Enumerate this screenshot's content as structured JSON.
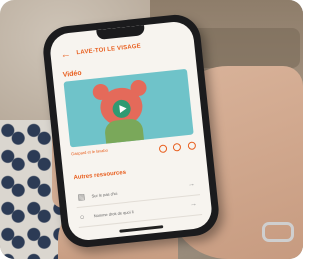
{
  "app": {
    "title": "LAVE-TOI LE VISAGE",
    "back_icon": "arrow-left-icon",
    "accent": "#e85d1c"
  },
  "video": {
    "section_label": "Vidéo",
    "caption": "Gaspard et le lavabo",
    "play_icon": "play-icon"
  },
  "resources": {
    "section_label": "Autres ressources",
    "items": [
      {
        "label": "Sur le pas d'ici",
        "icon": "document-icon"
      },
      {
        "label": "Nomme droit de quoi il",
        "icon": "audio-icon"
      }
    ]
  }
}
